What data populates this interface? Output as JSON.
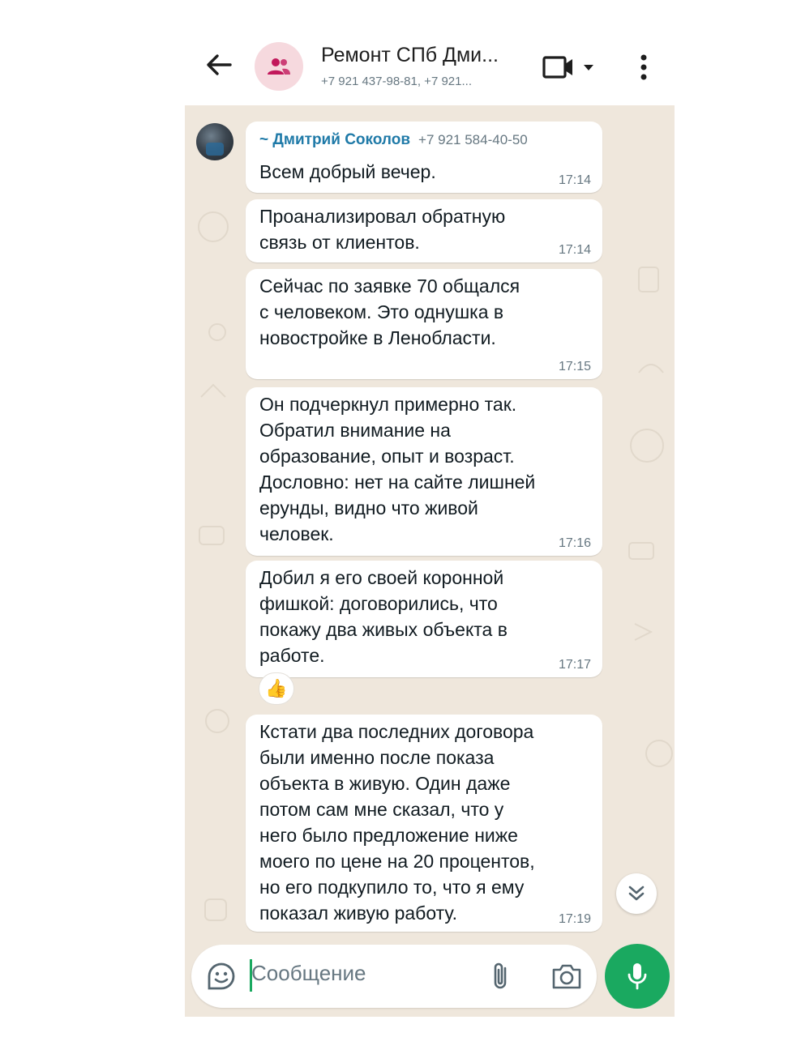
{
  "header": {
    "title": "Ремонт СПб Дми...",
    "subtitle": "+7 921 437-98-81, +7 921...",
    "icons": {
      "back": "back-arrow-icon",
      "group": "group-icon",
      "video": "video-call-icon",
      "menu": "more-vert-icon"
    }
  },
  "colors": {
    "accent": "#1aa960",
    "sender": "#1f7aa8",
    "chat_bg": "#efe7dc"
  },
  "messages": [
    {
      "sender": "~ Дмитрий Соколов",
      "phone": "+7 921 584-40-50",
      "text": "Всем добрый вечер.",
      "time": "17:14"
    },
    {
      "text": "Проанализировал обратную\nсвязь от клиентов.",
      "time": "17:14"
    },
    {
      "text": "Сейчас по заявке 70 общался\nс человеком. Это однушка в\nновостройке в Ленобласти.",
      "time": "17:15"
    },
    {
      "text": "Он подчеркнул примерно так.\nОбратил внимание на\nобразование, опыт и возраст.\nДословно: нет на сайте лишней\nерунды, видно что живой\nчеловек.",
      "time": "17:16"
    },
    {
      "text": "Добил я его своей коронной\nфишкой: договорились, что\nпокажу два живых объекта в\nработе.",
      "time": "17:17",
      "reaction": "👍"
    },
    {
      "text": "Кстати два последних договора\nбыли именно после показа\nобъекта в живую. Один даже\nпотом сам мне сказал, что у\nнего было предложение ниже\nмоего по цене на 20 процентов,\nно его подкупило то, что я ему\nпоказал живую работу.",
      "time": "17:19"
    }
  ],
  "input": {
    "placeholder": "Сообщение"
  }
}
